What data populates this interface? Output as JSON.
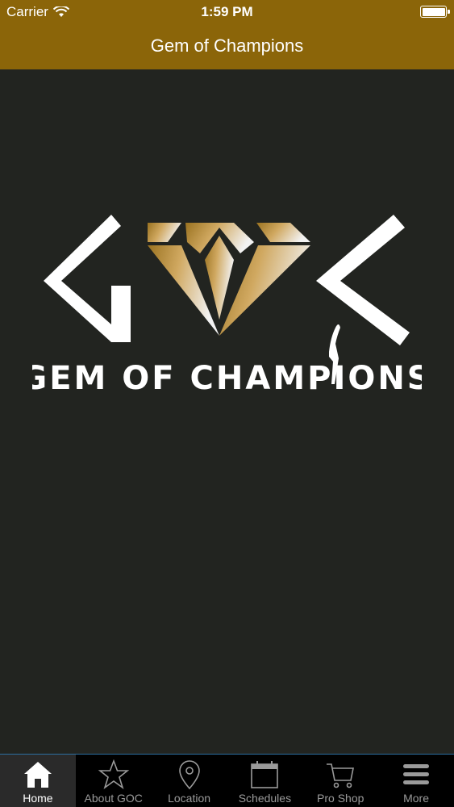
{
  "status_bar": {
    "carrier": "Carrier",
    "time": "1:59 PM"
  },
  "navbar": {
    "title": "Gem of Champions"
  },
  "logo": {
    "letters": [
      "G",
      "C"
    ],
    "wordmark": "GEM OF CHAMPIONS"
  },
  "tabbar": {
    "items": [
      {
        "label": "Home",
        "icon": "home-icon",
        "active": true
      },
      {
        "label": "About GOC",
        "icon": "star-icon",
        "active": false
      },
      {
        "label": "Location",
        "icon": "map-pin-icon",
        "active": false
      },
      {
        "label": "Schedules",
        "icon": "calendar-icon",
        "active": false
      },
      {
        "label": "Pro Shop",
        "icon": "cart-icon",
        "active": false
      },
      {
        "label": "More",
        "icon": "menu-icon",
        "active": false
      }
    ]
  },
  "colors": {
    "header": "#8b6509",
    "background": "#222420",
    "tabbar": "#000000",
    "gold": "#c8a050"
  }
}
